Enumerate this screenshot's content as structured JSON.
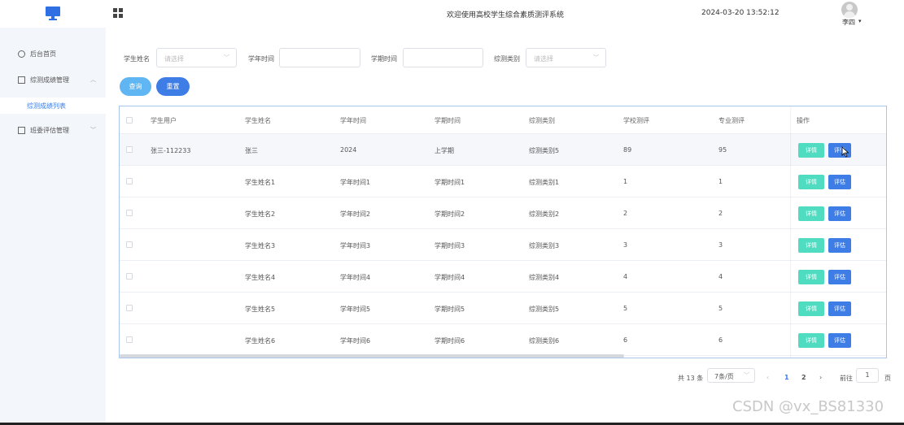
{
  "header": {
    "title": "欢迎使用高校学生综合素质测评系统",
    "datetime": "2024-03-20 13:52:12",
    "username": "李四"
  },
  "sidebar": {
    "items": [
      {
        "label": "后台首页",
        "icon": "clock-icon"
      },
      {
        "label": "综测成绩管理",
        "icon": "table-icon"
      },
      {
        "label": "综测成绩列表"
      },
      {
        "label": "班委评估管理",
        "icon": "table-icon"
      }
    ]
  },
  "filters": {
    "student_name_label": "学生姓名",
    "student_name_placeholder": "请选择",
    "year_label": "学年时间",
    "term_label": "学期时间",
    "category_label": "综测类别",
    "category_placeholder": "请选择"
  },
  "actions": {
    "query": "查询",
    "reset": "重置"
  },
  "table": {
    "headers": [
      "学生用户",
      "学生姓名",
      "学年时间",
      "学期时间",
      "综测类别",
      "学校测评",
      "专业测评",
      "操作"
    ],
    "rows": [
      {
        "user": "张三-112233",
        "name": "张三",
        "year": "2024",
        "term": "上学期",
        "category": "综测类别5",
        "school": "89",
        "major": "95"
      },
      {
        "user": "",
        "name": "学生姓名1",
        "year": "学年时间1",
        "term": "学期时间1",
        "category": "综测类别1",
        "school": "1",
        "major": "1"
      },
      {
        "user": "",
        "name": "学生姓名2",
        "year": "学年时间2",
        "term": "学期时间2",
        "category": "综测类别2",
        "school": "2",
        "major": "2"
      },
      {
        "user": "",
        "name": "学生姓名3",
        "year": "学年时间3",
        "term": "学期时间3",
        "category": "综测类别3",
        "school": "3",
        "major": "3"
      },
      {
        "user": "",
        "name": "学生姓名4",
        "year": "学年时间4",
        "term": "学期时间4",
        "category": "综测类别4",
        "school": "4",
        "major": "4"
      },
      {
        "user": "",
        "name": "学生姓名5",
        "year": "学年时间5",
        "term": "学期时间5",
        "category": "综测类别5",
        "school": "5",
        "major": "5"
      },
      {
        "user": "",
        "name": "学生姓名6",
        "year": "学年时间6",
        "term": "学期时间6",
        "category": "综测类别6",
        "school": "6",
        "major": "6"
      }
    ],
    "detail_label": "详情",
    "eval_label": "评估"
  },
  "pagination": {
    "total": "共 13 条",
    "page_size": "7条/页",
    "pages": [
      "1",
      "2"
    ],
    "current": "1",
    "goto_label": "前往",
    "goto_value": "1",
    "page_suffix": "页"
  },
  "watermark": "CSDN @vx_BS81330",
  "colors": {
    "primary": "#3e7de6",
    "query": "#5fb6f2",
    "detail": "#4fdcc1",
    "sidebar_bg": "#f3f6fb"
  }
}
